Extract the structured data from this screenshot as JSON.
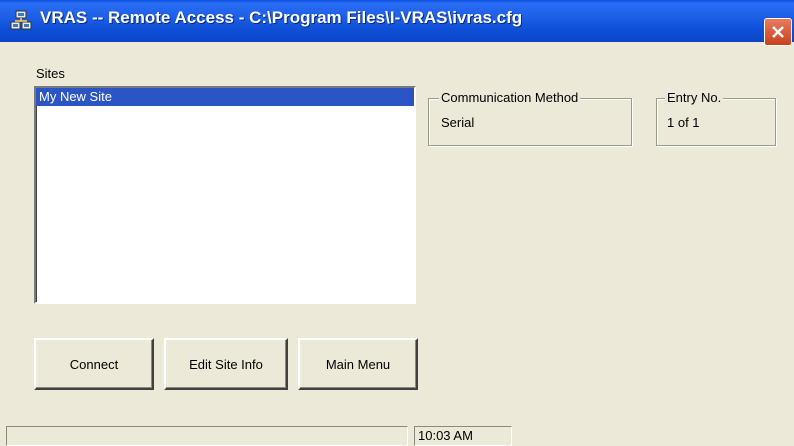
{
  "window": {
    "title": "VRAS -- Remote Access - C:\\Program Files\\I-VRAS\\ivras.cfg",
    "app_icon": "network-computers-icon",
    "close_icon": "close-icon"
  },
  "sites": {
    "label": "Sites",
    "items": [
      "My New Site"
    ],
    "selected_index": 0
  },
  "communication_method": {
    "label": "Communication Method",
    "value": "Serial"
  },
  "entry": {
    "label": "Entry No.",
    "value": "1 of 1"
  },
  "buttons": {
    "connect": "Connect",
    "edit_site_info": "Edit Site Info",
    "main_menu": "Main Menu"
  },
  "status": {
    "message": "",
    "time": "10:03 AM"
  },
  "colors": {
    "titlebar": "#1d5fe6",
    "selection": "#2b55c4",
    "face": "#ece9d8",
    "close": "#c9401c"
  }
}
